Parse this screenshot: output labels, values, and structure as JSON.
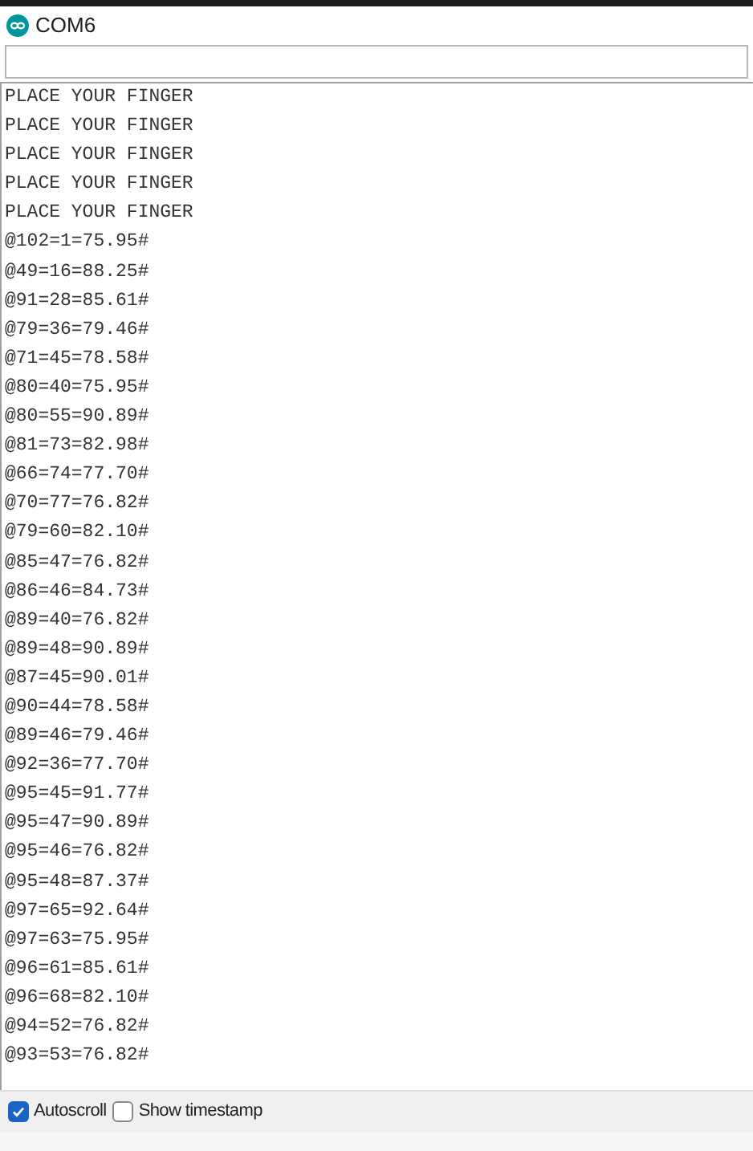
{
  "window": {
    "title": "COM6"
  },
  "output_lines": [
    "PLACE YOUR FINGER",
    "PLACE YOUR FINGER",
    "PLACE YOUR FINGER",
    "PLACE YOUR FINGER",
    "PLACE YOUR FINGER",
    "@102=1=75.95#",
    "@49=16=88.25#",
    "@91=28=85.61#",
    "@79=36=79.46#",
    "@71=45=78.58#",
    "@80=40=75.95#",
    "@80=55=90.89#",
    "@81=73=82.98#",
    "@66=74=77.70#",
    "@70=77=76.82#",
    "@79=60=82.10#",
    "@85=47=76.82#",
    "@86=46=84.73#",
    "@89=40=76.82#",
    "@89=48=90.89#",
    "@87=45=90.01#",
    "@90=44=78.58#",
    "@89=46=79.46#",
    "@92=36=77.70#",
    "@95=45=91.77#",
    "@95=47=90.89#",
    "@95=46=76.82#",
    "@95=48=87.37#",
    "@97=65=92.64#",
    "@97=63=75.95#",
    "@96=61=85.61#",
    "@96=68=82.10#",
    "@94=52=76.82#",
    "@93=53=76.82#"
  ],
  "options": [
    {
      "label": "Autoscroll",
      "checked": true
    },
    {
      "label": "Show timestamp",
      "checked": false
    }
  ]
}
